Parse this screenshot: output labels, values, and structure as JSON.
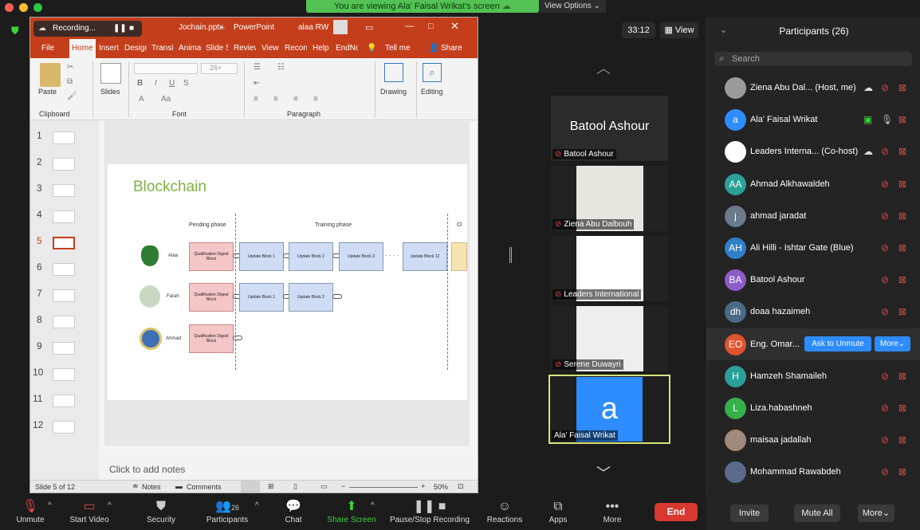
{
  "banner": {
    "text": "You are viewing Ala' Faisal Wrikat's screen",
    "view_options": "View Options ⌄"
  },
  "recording": {
    "label": "Recording..."
  },
  "ppt": {
    "filename": "Jochain.pptx",
    "app": "PowerPoint",
    "user": "alaa RW",
    "tabs": [
      "File",
      "Home",
      "Insert",
      "Design",
      "Transit",
      "Anima",
      "Slide S",
      "Review",
      "View",
      "Recon",
      "Help",
      "EndNo"
    ],
    "tell_me": "Tell me",
    "share": "Share",
    "ribbon": {
      "paste": "Paste",
      "slides": "Slides",
      "drawing": "Drawing",
      "editing": "Editing",
      "groups": [
        "Clipboard",
        "Font",
        "Paragraph"
      ],
      "font_size": "26+"
    },
    "slide_numbers": [
      "1",
      "2",
      "3",
      "4",
      "5",
      "6",
      "7",
      "8",
      "9",
      "10",
      "11",
      "12"
    ],
    "current_slide": "5",
    "slide": {
      "title": "Blockchain",
      "phases": [
        "Pending phase",
        "Training phase",
        "Cl"
      ],
      "rows": [
        {
          "name": "Alaa",
          "blocks": [
            "Update Block 1",
            "Update Block 2",
            "Update Block 3",
            "Update Block 12"
          ]
        },
        {
          "name": "Farah",
          "blocks": [
            "Update Block 1",
            "Update Block 2"
          ]
        },
        {
          "name": "Ahmad",
          "blocks": []
        }
      ],
      "qual_block": "Qualification Digest Block",
      "ellipsis": "· · · ·"
    },
    "notes_placeholder": "Click to add notes",
    "status": {
      "slide_of": "Slide 5 of 12",
      "notes": "Notes",
      "comments": "Comments",
      "zoom": "50%"
    }
  },
  "timer": "33:12",
  "view_button": "View",
  "tiles": [
    {
      "name": "Batool Ashour",
      "big": "Batool Ashour"
    },
    {
      "name": "Ziena Abu Dalbouh"
    },
    {
      "name": "Leaders International"
    },
    {
      "name": "Serene Duwayri"
    },
    {
      "name": "Ala' Faisal Wrikat",
      "letter": "a"
    }
  ],
  "participants": {
    "title": "Participants (26)",
    "search_placeholder": "Search",
    "list": [
      {
        "name": "Ziena Abu Dal... (Host, me)",
        "initials": "",
        "color": "#9b9b9b"
      },
      {
        "name": "Ala' Faisal Wrikat",
        "initials": "a",
        "color": "#2d8cff"
      },
      {
        "name": "Leaders Interna... (Co-host)",
        "initials": "",
        "color": "#ffffff"
      },
      {
        "name": "Ahmad Alkhawaldeh",
        "initials": "AA",
        "color": "#2aa198"
      },
      {
        "name": "ahmad jaradat",
        "initials": "j",
        "color": "#6b7b8c"
      },
      {
        "name": "Ali Hilli - Ishtar Gate (Blue)",
        "initials": "AH",
        "color": "#2f80c9"
      },
      {
        "name": "Batool Ashour",
        "initials": "BA",
        "color": "#8e5cc8"
      },
      {
        "name": "doaa hazaimeh",
        "initials": "dh",
        "color": "#4c6a87"
      },
      {
        "name": "Eng. Omar...",
        "initials": "EO",
        "color": "#e0532f"
      },
      {
        "name": "Hamzeh Shamaileh",
        "initials": "H",
        "color": "#2aa198"
      },
      {
        "name": "Liza.habashneh",
        "initials": "L",
        "color": "#36b04a"
      },
      {
        "name": "maisaa jadallah",
        "initials": "",
        "color": "#a08a7a"
      },
      {
        "name": "Mohammad Rawabdeh",
        "initials": "",
        "color": "#5a6b8c"
      }
    ],
    "ask_unmute": "Ask to Unmute",
    "more": "More⌄",
    "footer": {
      "invite": "Invite",
      "mute_all": "Mute All",
      "more": "More⌄"
    }
  },
  "toolbar": {
    "unmute": "Unmute",
    "start_video": "Start Video",
    "security": "Security",
    "participants": "Participants",
    "participants_count": "26",
    "chat": "Chat",
    "share_screen": "Share Screen",
    "pause_stop": "Pause/Stop Recording",
    "reactions": "Reactions",
    "apps": "Apps",
    "more": "More",
    "end": "End"
  }
}
